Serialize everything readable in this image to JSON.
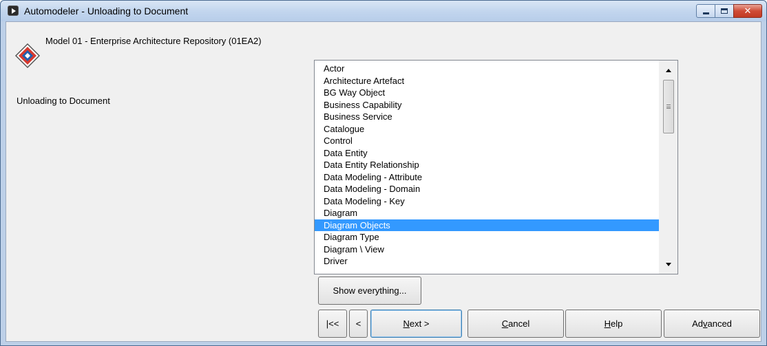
{
  "window": {
    "title": "Automodeler - Unloading to Document"
  },
  "header": {
    "model_title": "Model 01 - Enterprise Architecture Repository (01EA2)",
    "subtitle": "Unloading to Document"
  },
  "object_list": {
    "items": [
      "Actor",
      "Architecture Artefact",
      "BG Way Object",
      "Business Capability",
      "Business Service",
      "Catalogue",
      "Control",
      "Data Entity",
      "Data Entity Relationship",
      "Data Modeling - Attribute",
      "Data Modeling - Domain",
      "Data Modeling - Key",
      "Diagram",
      "Diagram Objects",
      "Diagram Type",
      "Diagram \\ View",
      "Driver"
    ],
    "selected": "Diagram Objects"
  },
  "buttons": {
    "show_everything": "Show everything...",
    "first": "|<<",
    "back": "<",
    "next_prefix": "N",
    "next_rest": "ext >",
    "cancel_prefix": "C",
    "cancel_rest": "ancel",
    "help_prefix": "H",
    "help_rest": "elp",
    "advanced_a": "Ad",
    "advanced_u": "v",
    "advanced_b": "anced"
  },
  "colors": {
    "selection": "#3399ff",
    "titlebar": "#c3d6ee",
    "close": "#cf4b35"
  },
  "icons": {
    "app": "app-play-icon",
    "logo": "diamond-logo-icon"
  }
}
